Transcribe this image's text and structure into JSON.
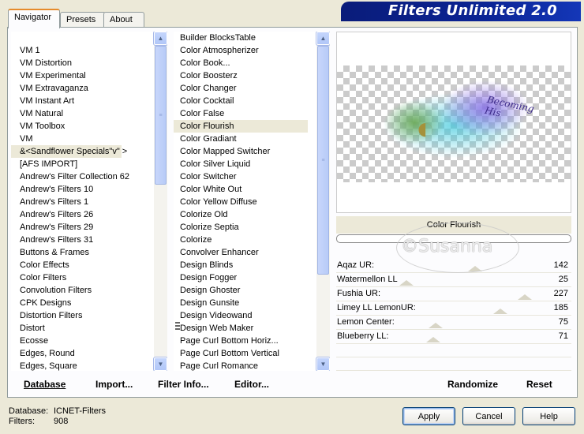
{
  "window": {
    "banner_title": "Filters Unlimited 2.0"
  },
  "tabs": [
    {
      "label": "Navigator",
      "active": true
    },
    {
      "label": "Presets",
      "active": false
    },
    {
      "label": "About",
      "active": false
    }
  ],
  "categories": {
    "items": [
      "VM 1",
      "VM Distortion",
      "VM Experimental",
      "VM Extravaganza",
      "VM Instant Art",
      "VM Natural",
      "VM Toolbox",
      "VM",
      "&<Sandflower Specials\"v\" >",
      "[AFS IMPORT]",
      "Andrew's Filter Collection 62",
      "Andrew's Filters 10",
      "Andrew's Filters 1",
      "Andrew's Filters 26",
      "Andrew's Filters 29",
      "Andrew's Filters 31",
      "Buttons & Frames",
      "Color Effects",
      "Color Filters",
      "Convolution Filters",
      "CPK Designs",
      "Distortion Filters",
      "Distort",
      "Ecosse",
      "Edges, Round",
      "Edges, Square"
    ],
    "selected_index": 8
  },
  "filters": {
    "items": [
      "Builder BlocksTable",
      "Color Atmospherizer",
      "Color Book...",
      "Color Boosterz",
      "Color Changer",
      "Color Cocktail",
      "Color False",
      "Color Flourish",
      "Color Gradiant",
      "Color Mapped Switcher",
      "Color Silver Liquid",
      "Color Switcher",
      "Color White Out",
      "Color Yellow Diffuse",
      "Colorize Old",
      "Colorize Septia",
      "Colorize",
      "Convolver Enhancer",
      "Design Blinds",
      "Design Fogger",
      "Design Ghoster",
      "Design Gunsite",
      "Design Videowand",
      "Design Web Maker",
      "Page Curl Bottom Horiz...",
      "Page Curl Bottom Vertical",
      "Page Curl Romance"
    ],
    "selected_index": 7
  },
  "preview": {
    "image_text": "Becoming His",
    "filter_name": "Color Flourish",
    "progress": 0,
    "watermark": "©Susanna"
  },
  "sliders": [
    {
      "label": "Aqaz UR:",
      "value": "142",
      "level": 0.557
    },
    {
      "label": "Watermellon LL",
      "value": "25",
      "level": 0.098
    },
    {
      "label": "Fushia UR:",
      "value": "227",
      "level": 0.89
    },
    {
      "label": "Limey LL LemonUR:",
      "value": "185",
      "level": 0.725
    },
    {
      "label": "Lemon Center:",
      "value": "75",
      "level": 0.294
    },
    {
      "label": "Blueberry LL:",
      "value": "71",
      "level": 0.278
    }
  ],
  "footer": {
    "database": "Database",
    "import": "Import...",
    "filter_info": "Filter Info...",
    "editor": "Editor...",
    "randomize": "Randomize",
    "reset": "Reset"
  },
  "status": {
    "database_label": "Database:",
    "database_value": "ICNET-Filters",
    "filters_label": "Filters:",
    "filters_value": "908"
  },
  "buttons": {
    "apply": "Apply",
    "cancel": "Cancel",
    "help": "Help"
  }
}
